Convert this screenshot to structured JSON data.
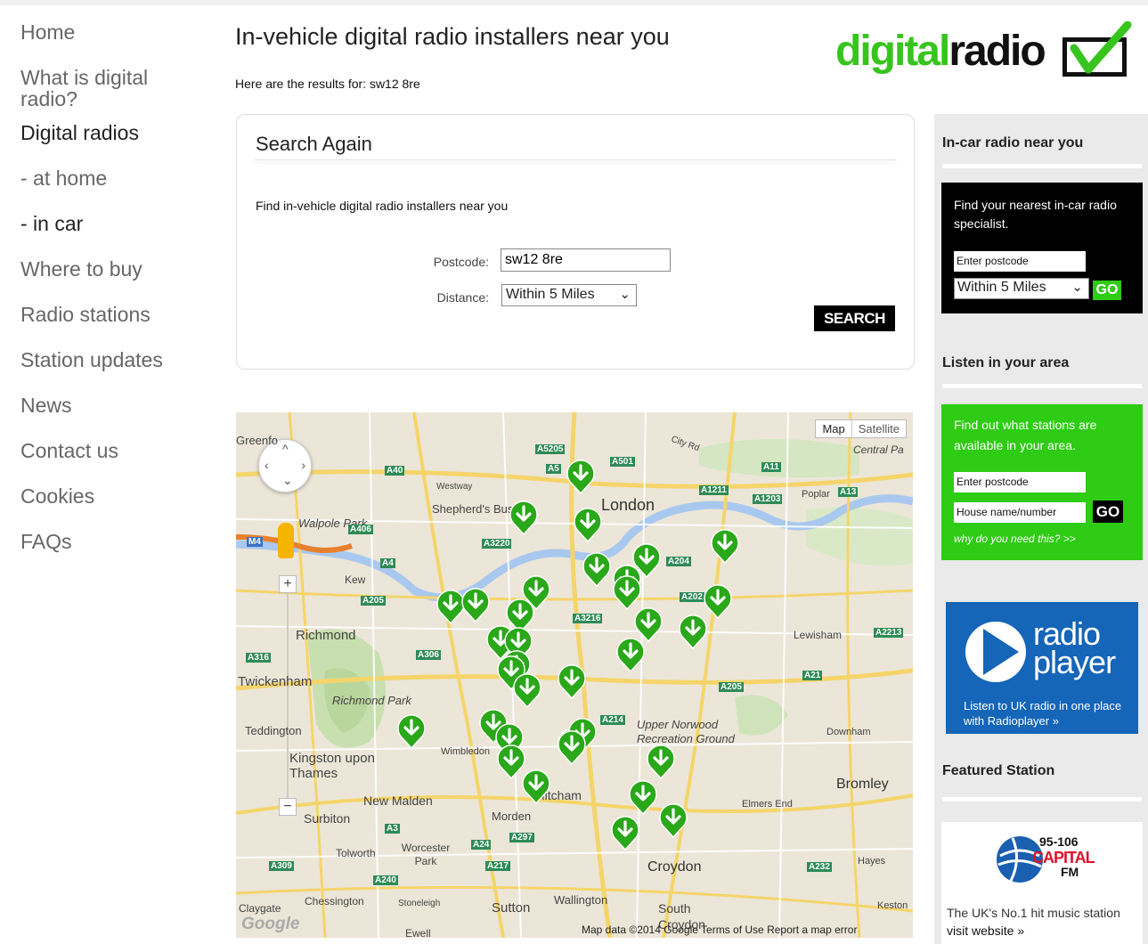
{
  "nav": {
    "items": [
      "Home",
      "What is digital radio?",
      "Digital radios",
      "- at home",
      "- in car",
      "Where to buy",
      "Radio stations",
      "Station updates",
      "News",
      "Contact us",
      "Cookies",
      "FAQs"
    ]
  },
  "header": {
    "title": "In-vehicle digital radio installers near you",
    "results": "Here are the results for: sw12 8re",
    "logo_part1": "digital",
    "logo_part2": "radio"
  },
  "search": {
    "title": "Search Again",
    "description": "Find in-vehicle digital radio installers near you",
    "postcode_label": "Postcode:",
    "postcode_value": "sw12 8re",
    "distance_label": "Distance:",
    "distance_value": "Within 5 Miles",
    "button": "SEARCH"
  },
  "map": {
    "type_map": "Map",
    "type_satellite": "Satellite",
    "attribution": "Map data ©2014 Google   Terms of Use   Report a map error",
    "watermark": "Google",
    "places": [
      "London",
      "Shepherd's Bush",
      "Westway",
      "Walpole Park",
      "Kew",
      "Richmond",
      "Twickenham",
      "Richmond Park",
      "Teddington",
      "Kingston upon Thames",
      "New Malden",
      "Surbiton",
      "Wimbledon",
      "Mitcham",
      "Morden",
      "Croydon",
      "Sutton",
      "Wallington",
      "Chessington",
      "Tolworth",
      "Worcester Park",
      "Upper Norwood Recreation Ground",
      "Lewisham",
      "Downham",
      "Bromley",
      "Elmers End",
      "Hayes",
      "Poplar",
      "Central Pa",
      "Claygate",
      "Ewell",
      "South Croydon",
      "Stoneleigh",
      "Greenfo",
      "City Rd",
      "Keston"
    ],
    "roads": [
      "A40",
      "A5205",
      "A501",
      "A11",
      "A1211",
      "A1203",
      "A13",
      "A406",
      "A4",
      "A3220",
      "A205",
      "A3216",
      "A306",
      "A316",
      "A214",
      "A205",
      "A21",
      "A2213",
      "A3",
      "A24",
      "A297",
      "A217",
      "A240",
      "A232",
      "A309",
      "A202",
      "A5",
      "M4",
      "A204"
    ],
    "marker_count": 34
  },
  "sidebar": {
    "incar_heading": "In-car radio near you",
    "incar_text": "Find your nearest in-car radio specialist.",
    "incar_placeholder": "Enter postcode",
    "incar_distance": "Within 5 Miles",
    "incar_go": "GO",
    "area_heading": "Listen in your area",
    "area_text": "Find out what stations are available in your area.",
    "area_postcode_placeholder": "Enter postcode",
    "area_house_placeholder": "House name/number",
    "area_go": "GO",
    "area_why": "why do you need this? >>",
    "radioplayer_name": "radio player",
    "radioplayer_tag": "Listen to UK radio in one place with Radioplayer »",
    "featured_heading": "Featured Station",
    "capital_freq": "95-106",
    "capital_name": "CAPITAL",
    "capital_fm": "FM",
    "featured_caption": "The UK's No.1 hit music station",
    "featured_link": "visit website »",
    "colors": {
      "green": "#2ecc14",
      "logo_green": "#37c41e",
      "radioplayer_blue": "#1565b8",
      "capital_red": "#e0102a"
    }
  }
}
